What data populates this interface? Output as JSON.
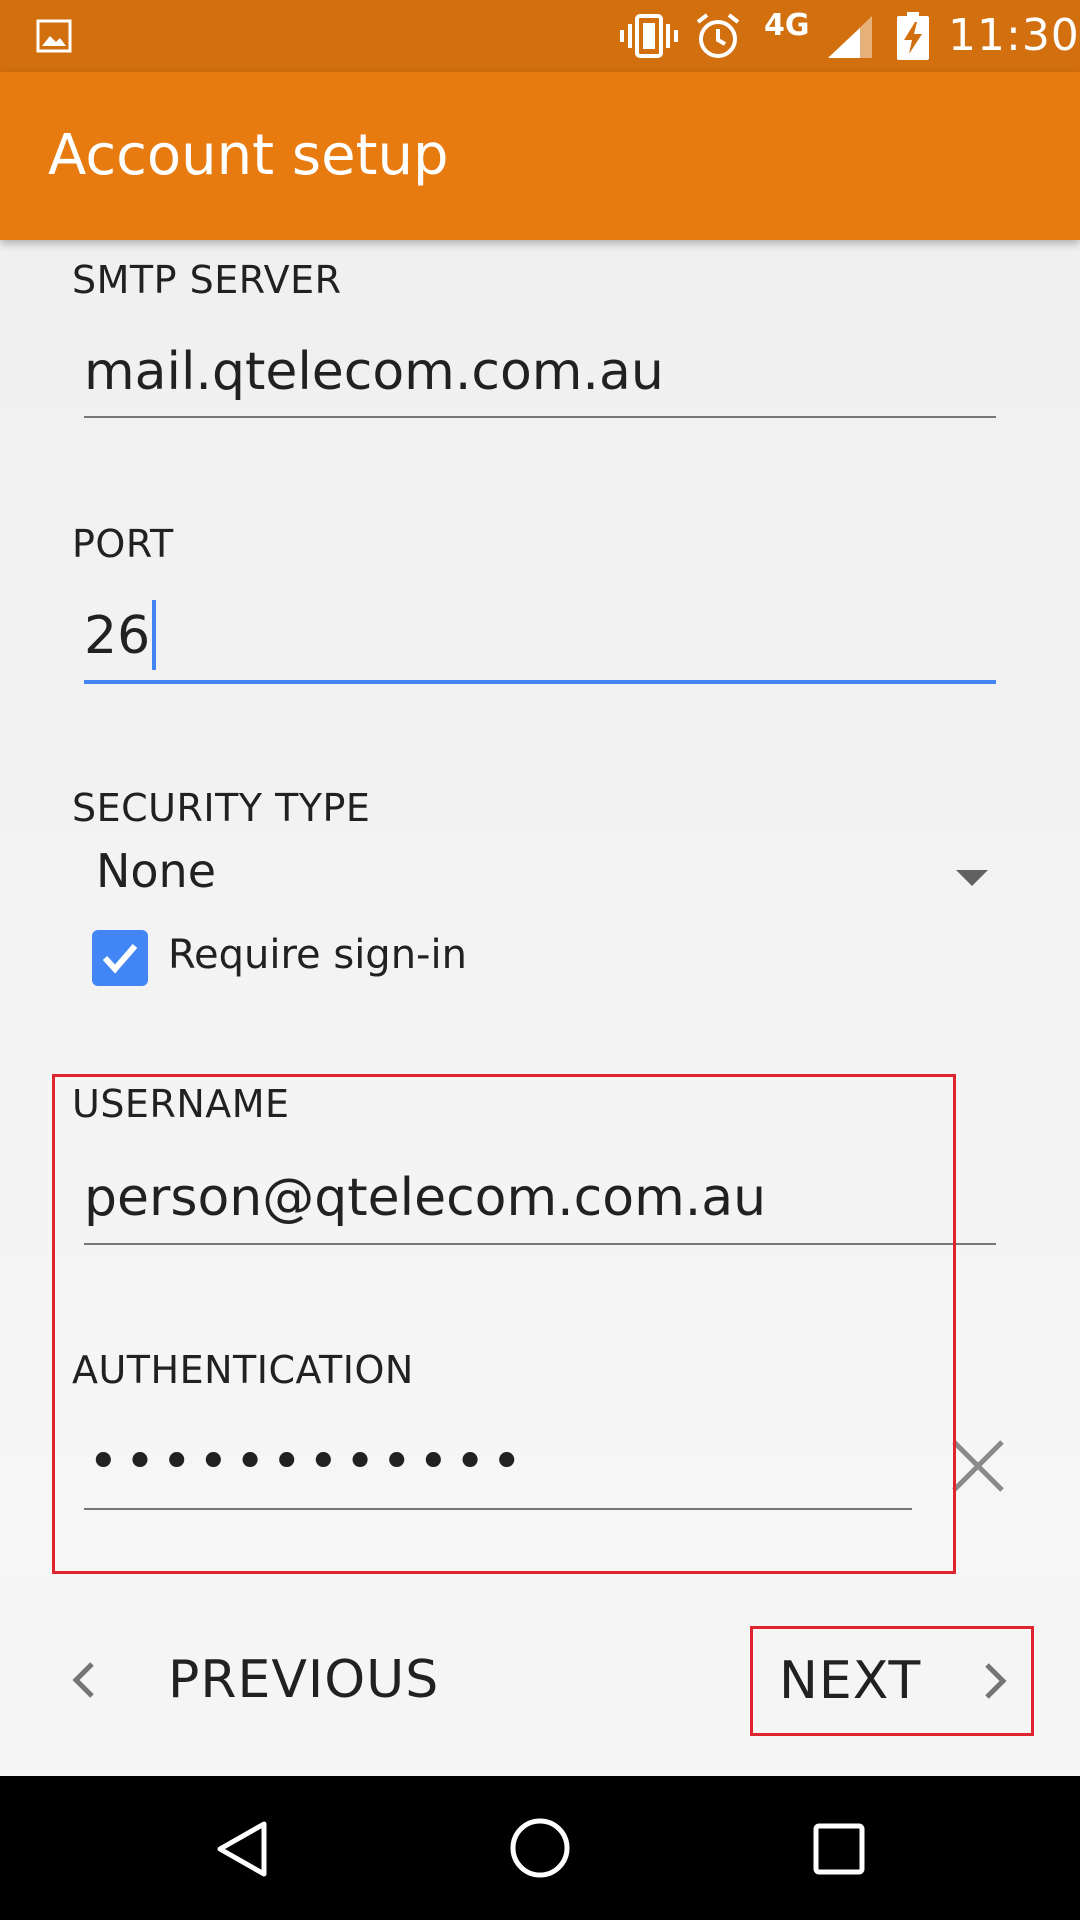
{
  "status_bar": {
    "network": "4G",
    "time": "11:30",
    "icons": [
      "gallery-icon",
      "vibrate-icon",
      "alarm-icon",
      "signal-icon",
      "battery-charging-icon"
    ]
  },
  "app_bar": {
    "title": "Account setup"
  },
  "form": {
    "smtp_server": {
      "label": "SMTP SERVER",
      "value": "mail.qtelecom.com.au"
    },
    "port": {
      "label": "PORT",
      "value": "26",
      "focused": true
    },
    "security_type": {
      "label": "SECURITY TYPE",
      "value": "None"
    },
    "require_signin": {
      "label": "Require sign-in",
      "checked": true
    },
    "username": {
      "label": "USERNAME",
      "value": "person@qtelecom.com.au"
    },
    "authentication": {
      "label": "AUTHENTICATION",
      "value": "••••••••••••"
    }
  },
  "buttons": {
    "previous_label": "PREVIOUS",
    "next_label": "NEXT"
  },
  "colors": {
    "status_bar": "#d26f0e",
    "app_bar": "#e87b0f",
    "accent": "#4285f4",
    "highlight": "#e0242f"
  }
}
